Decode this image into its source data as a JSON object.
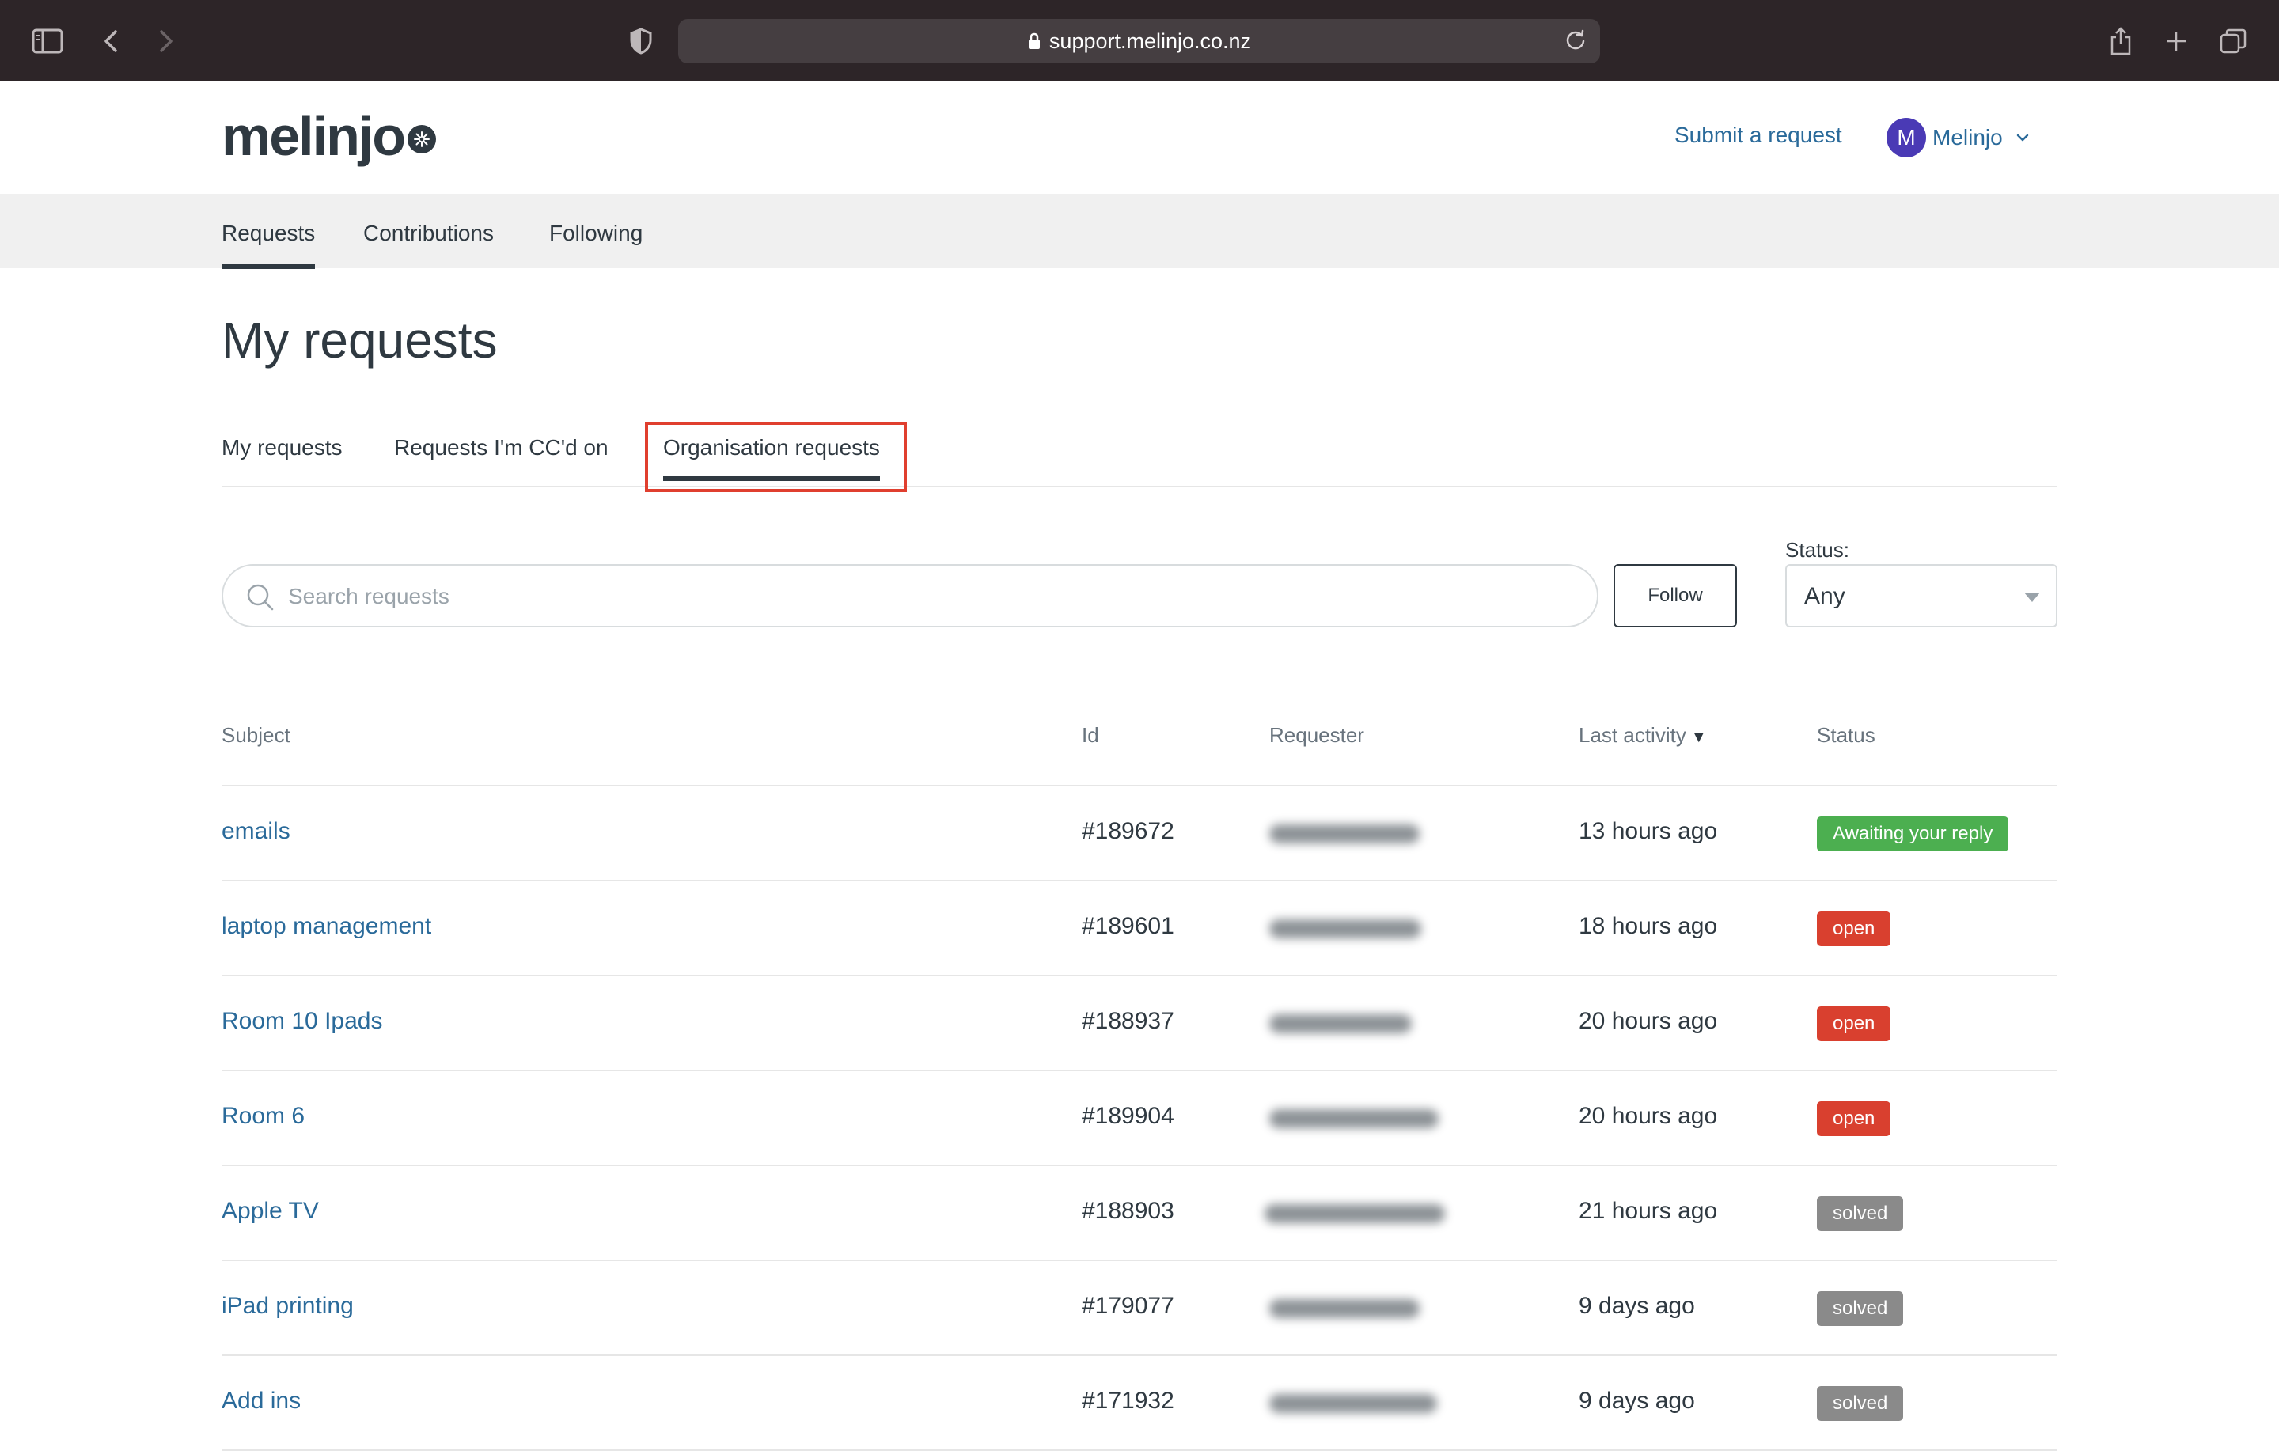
{
  "browser": {
    "url": "support.melinjo.co.nz",
    "icons": [
      "sidebar-icon",
      "back-icon",
      "forward-icon",
      "shield-icon",
      "lock-icon",
      "reload-icon",
      "share-icon",
      "new-tab-icon",
      "tabs-overview-icon"
    ]
  },
  "header": {
    "logo": "melinjo",
    "submit_link": "Submit a request",
    "user": {
      "initial": "M",
      "name": "Melinjo"
    }
  },
  "subnav": {
    "items": [
      "Requests",
      "Contributions",
      "Following"
    ],
    "active": "Requests"
  },
  "page": {
    "title": "My requests"
  },
  "tabs": {
    "items": [
      "My requests",
      "Requests I'm CC'd on",
      "Organisation requests"
    ],
    "active": "Organisation requests",
    "highlight_color": "#e03f2f"
  },
  "filters": {
    "search_placeholder": "Search requests",
    "follow_label": "Follow",
    "status_label": "Status:",
    "status_value": "Any"
  },
  "table": {
    "columns": [
      "Subject",
      "Id",
      "Requester",
      "Last activity",
      "Status"
    ],
    "sort_column": "Last activity",
    "sort_indicator": "▼",
    "rows": [
      {
        "subject": "emails",
        "id": "#189672",
        "last_activity": "13 hours ago",
        "status": "Awaiting your reply"
      },
      {
        "subject": "laptop management",
        "id": "#189601",
        "last_activity": "18 hours ago",
        "status": "open"
      },
      {
        "subject": "Room 10 Ipads",
        "id": "#188937",
        "last_activity": "20 hours ago",
        "status": "open"
      },
      {
        "subject": "Room 6",
        "id": "#189904",
        "last_activity": "20 hours ago",
        "status": "open"
      },
      {
        "subject": "Apple TV",
        "id": "#188903",
        "last_activity": "21 hours ago",
        "status": "solved"
      },
      {
        "subject": "iPad printing",
        "id": "#179077",
        "last_activity": "9 days ago",
        "status": "solved"
      },
      {
        "subject": "Add ins",
        "id": "#171932",
        "last_activity": "9 days ago",
        "status": "solved"
      }
    ]
  },
  "status_colors": {
    "Awaiting your reply": "#4caf50",
    "open": "#d9402f",
    "solved": "#8a8a8a"
  },
  "colors": {
    "link": "#2a6a9a",
    "text": "#2f3941",
    "chrome": "#2d2528",
    "avatar": "#4a3ab5"
  }
}
